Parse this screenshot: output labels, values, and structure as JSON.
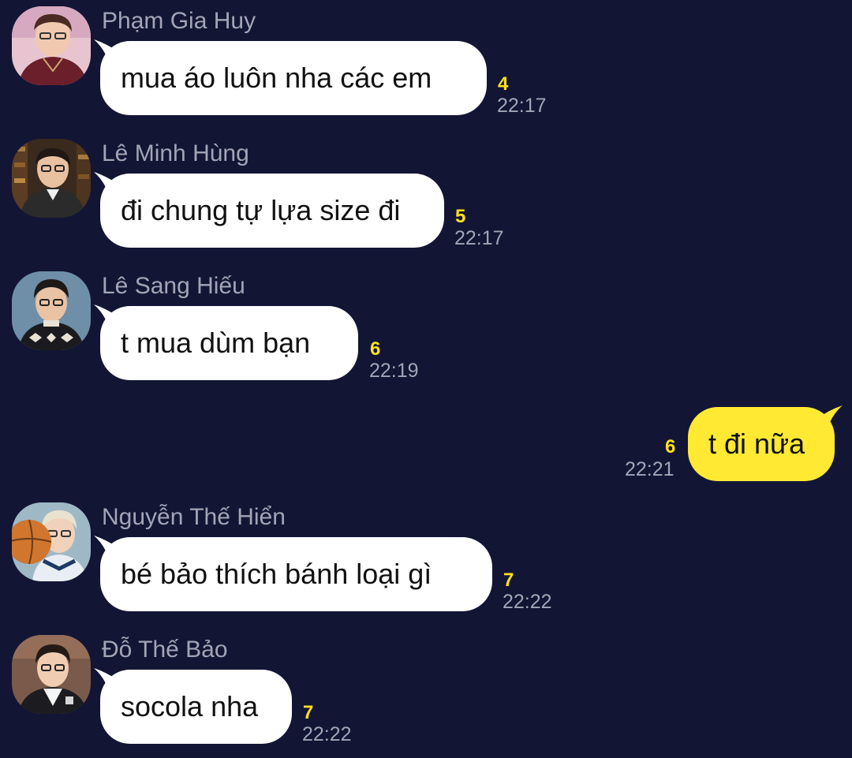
{
  "messages": [
    {
      "sender": "Phạm Gia Huy",
      "text": "mua áo luôn nha các em",
      "count": "4",
      "time": "22:17",
      "avatar_icon": "avatar-pham-gia-huy"
    },
    {
      "sender": "Lê Minh Hùng",
      "text": "đi chung tự lựa size đi",
      "count": "5",
      "time": "22:17",
      "avatar_icon": "avatar-le-minh-hung"
    },
    {
      "sender": "Lê Sang Hiếu",
      "text": "t mua dùm bạn",
      "count": "6",
      "time": "22:19",
      "avatar_icon": "avatar-le-sang-hieu"
    },
    {
      "own": true,
      "text": "t đi nữa",
      "count": "6",
      "time": "22:21"
    },
    {
      "sender": "Nguyễn Thế Hiển",
      "text": "bé bảo thích bánh loại gì",
      "count": "7",
      "time": "22:22",
      "avatar_icon": "avatar-nguyen-the-hien"
    },
    {
      "sender": "Đỗ Thế Bảo",
      "text": "socola nha",
      "count": "7",
      "time": "22:22",
      "avatar_icon": "avatar-do-the-bao"
    }
  ],
  "colors": {
    "background": "#131535",
    "incoming_bubble": "#ffffff",
    "outgoing_bubble": "#ffe933",
    "unread_count": "#ffe11a",
    "meta_text": "#a3a5b6"
  }
}
